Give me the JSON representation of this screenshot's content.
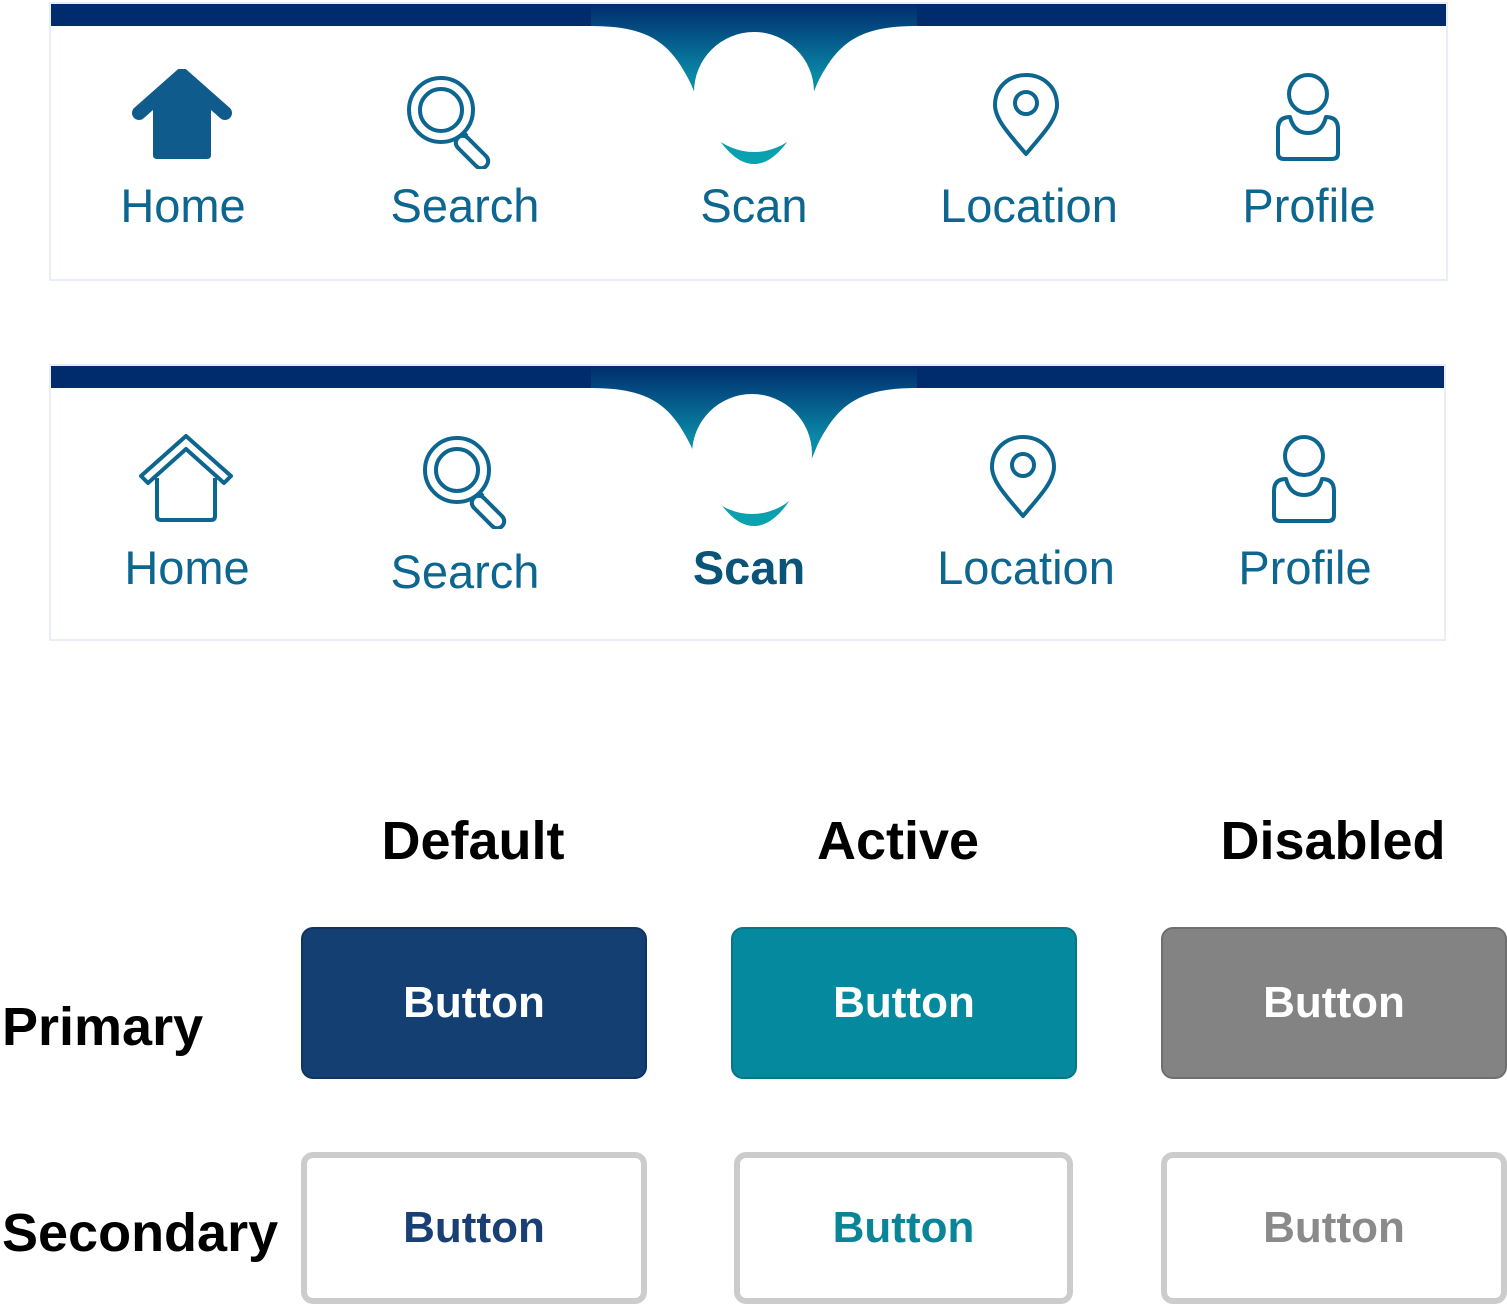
{
  "navbars": [
    {
      "items": [
        {
          "id": "home",
          "label": "Home",
          "icon": "home-filled-icon",
          "bold": false
        },
        {
          "id": "search",
          "label": "Search",
          "icon": "search-icon",
          "bold": false
        },
        {
          "id": "scan",
          "label": "Scan",
          "icon": "scan-circle-icon",
          "bold": false
        },
        {
          "id": "location",
          "label": "Location",
          "icon": "location-pin-icon",
          "bold": false
        },
        {
          "id": "profile",
          "label": "Profile",
          "icon": "user-icon",
          "bold": false
        }
      ]
    },
    {
      "items": [
        {
          "id": "home",
          "label": "Home",
          "icon": "home-outline-icon",
          "bold": false
        },
        {
          "id": "search",
          "label": "Search",
          "icon": "search-icon",
          "bold": false
        },
        {
          "id": "scan",
          "label": "Scan",
          "icon": "scan-circle-icon",
          "bold": true
        },
        {
          "id": "location",
          "label": "Location",
          "icon": "location-pin-icon",
          "bold": false
        },
        {
          "id": "profile",
          "label": "Profile",
          "icon": "user-icon",
          "bold": false
        }
      ]
    }
  ],
  "buttons": {
    "columns": [
      "Default",
      "Active",
      "Disabled"
    ],
    "rows": [
      "Primary",
      "Secondary"
    ],
    "label": "Button"
  },
  "colors": {
    "nav_bar_top": "#002c6e",
    "nav_accent_teal": "#0ba3b0",
    "nav_text": "#0d6690",
    "primary_default": "#143f72",
    "primary_active": "#04899e",
    "primary_disabled": "#838383",
    "secondary_default_text": "#1a3f74",
    "secondary_active_text": "#0a8597",
    "secondary_disabled_text": "#8a8a8a",
    "secondary_border": "#cccccc"
  }
}
